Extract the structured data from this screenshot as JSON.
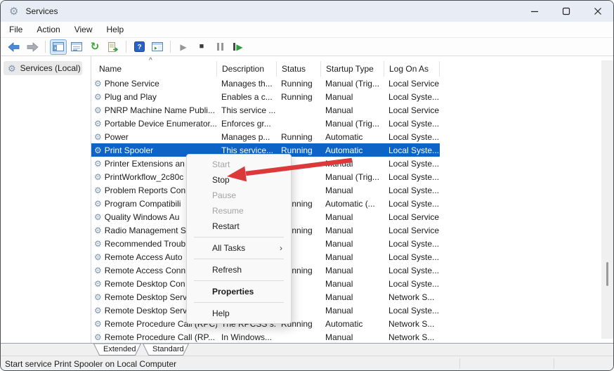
{
  "window": {
    "title": "Services"
  },
  "window_controls": {
    "minimize": "minimize",
    "maximize": "maximize",
    "close": "close"
  },
  "menubar": [
    "File",
    "Action",
    "View",
    "Help"
  ],
  "toolbar": {
    "buttons": [
      "back",
      "forward",
      "show-console-tree",
      "properties-window",
      "refresh",
      "export-list",
      "help",
      "show-action-pane",
      "start-service",
      "stop-service",
      "pause-service",
      "restart-service"
    ]
  },
  "sidebar": {
    "root_label": "Services (Local)"
  },
  "table": {
    "columns": [
      "Name",
      "Description",
      "Status",
      "Startup Type",
      "Log On As"
    ],
    "sort": {
      "column": "Name",
      "direction": "ascending"
    },
    "rows": [
      {
        "name": "Phone Service",
        "description": "Manages th...",
        "status": "Running",
        "startup_type": "Manual (Trig...",
        "log_on_as": "Local Service",
        "selected": false
      },
      {
        "name": "Plug and Play",
        "description": "Enables a c...",
        "status": "Running",
        "startup_type": "Manual",
        "log_on_as": "Local Syste...",
        "selected": false
      },
      {
        "name": "PNRP Machine Name Publi...",
        "description": "This service ...",
        "status": "",
        "startup_type": "Manual",
        "log_on_as": "Local Service",
        "selected": false
      },
      {
        "name": "Portable Device Enumerator...",
        "description": "Enforces gr...",
        "status": "",
        "startup_type": "Manual (Trig...",
        "log_on_as": "Local Syste...",
        "selected": false
      },
      {
        "name": "Power",
        "description": "Manages p...",
        "status": "Running",
        "startup_type": "Automatic",
        "log_on_as": "Local Syste...",
        "selected": false
      },
      {
        "name": "Print Spooler",
        "description": "This service...",
        "status": "Running",
        "startup_type": "Automatic",
        "log_on_as": "Local Syste...",
        "selected": true
      },
      {
        "name": "Printer Extensions an",
        "description": "",
        "status": "",
        "startup_type": "Manual",
        "log_on_as": "Local Syste...",
        "selected": false
      },
      {
        "name": "PrintWorkflow_2c80c",
        "description": "",
        "status": "",
        "startup_type": "Manual (Trig...",
        "log_on_as": "Local Syste...",
        "selected": false
      },
      {
        "name": "Problem Reports Con",
        "description": "",
        "status": "",
        "startup_type": "Manual",
        "log_on_as": "Local Syste...",
        "selected": false
      },
      {
        "name": "Program Compatibili",
        "description": "",
        "status": "Running",
        "startup_type": "Automatic (...",
        "log_on_as": "Local Syste...",
        "selected": false
      },
      {
        "name": "Quality Windows Au",
        "description": "",
        "status": "",
        "startup_type": "Manual",
        "log_on_as": "Local Service",
        "selected": false
      },
      {
        "name": "Radio Management S",
        "description": "",
        "status": "Running",
        "startup_type": "Manual",
        "log_on_as": "Local Service",
        "selected": false
      },
      {
        "name": "Recommended Troub",
        "description": "",
        "status": "",
        "startup_type": "Manual",
        "log_on_as": "Local Syste...",
        "selected": false
      },
      {
        "name": "Remote Access Auto",
        "description": "",
        "status": "",
        "startup_type": "Manual",
        "log_on_as": "Local Syste...",
        "selected": false
      },
      {
        "name": "Remote Access Conn",
        "description": "",
        "status": "Running",
        "startup_type": "Manual",
        "log_on_as": "Local Syste...",
        "selected": false
      },
      {
        "name": "Remote Desktop Con",
        "description": "",
        "status": "",
        "startup_type": "Manual",
        "log_on_as": "Local Syste...",
        "selected": false
      },
      {
        "name": "Remote Desktop Serv",
        "description": "",
        "status": "",
        "startup_type": "Manual",
        "log_on_as": "Network S...",
        "selected": false
      },
      {
        "name": "Remote Desktop Serv",
        "description": "",
        "status": "",
        "startup_type": "Manual",
        "log_on_as": "Local Syste...",
        "selected": false
      },
      {
        "name": "Remote Procedure Call (RPC)",
        "description": "The RPCSS s...",
        "status": "Running",
        "startup_type": "Automatic",
        "log_on_as": "Network S...",
        "selected": false
      },
      {
        "name": "Remote Procedure Call (RP...",
        "description": "In Windows...",
        "status": "",
        "startup_type": "Manual",
        "log_on_as": "Network S...",
        "selected": false
      }
    ]
  },
  "context_menu": {
    "items": [
      {
        "label": "Start",
        "state": "disabled",
        "submenu": false,
        "divider_after": false
      },
      {
        "label": "Stop",
        "state": "normal",
        "submenu": false,
        "divider_after": false
      },
      {
        "label": "Pause",
        "state": "disabled",
        "submenu": false,
        "divider_after": false
      },
      {
        "label": "Resume",
        "state": "disabled",
        "submenu": false,
        "divider_after": false
      },
      {
        "label": "Restart",
        "state": "normal",
        "submenu": false,
        "divider_after": true
      },
      {
        "label": "All Tasks",
        "state": "normal",
        "submenu": true,
        "divider_after": true
      },
      {
        "label": "Refresh",
        "state": "normal",
        "submenu": false,
        "divider_after": true
      },
      {
        "label": "Properties",
        "state": "bold",
        "submenu": false,
        "divider_after": true
      },
      {
        "label": "Help",
        "state": "normal",
        "submenu": false,
        "divider_after": false
      }
    ]
  },
  "tabs": [
    "Extended",
    "Standard"
  ],
  "active_tab": "Extended",
  "statusbar": {
    "text": "Start service Print Spooler on Local Computer"
  },
  "annotation": {
    "type": "red-arrow",
    "points_to": "Stop"
  },
  "colors": {
    "selection_blue": "#0d64c6",
    "arrow_red": "#db3a3a",
    "titlebar_bg": "#e8edf5",
    "help_icon_blue": "#2a62c6"
  }
}
